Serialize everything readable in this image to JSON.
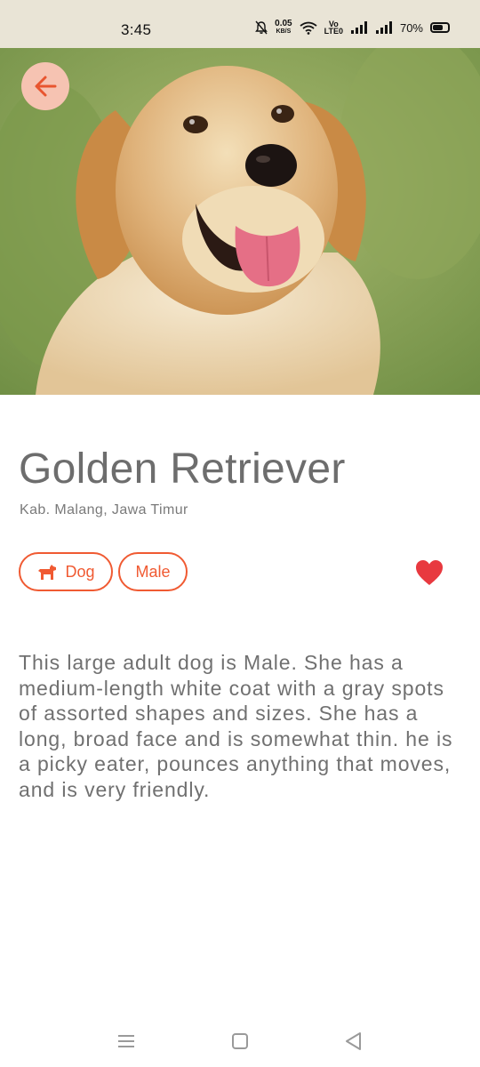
{
  "status_bar": {
    "time": "3:45",
    "net_speed_value": "0.05",
    "net_speed_unit": "KB/S",
    "volte_top": "Vo",
    "volte_bottom": "LTE0",
    "battery_percent": "70%",
    "battery_level": 0.7
  },
  "pet": {
    "name": "Golden Retriever",
    "location": "Kab. Malang, Jawa Timur",
    "type_label": "Dog",
    "gender_label": "Male",
    "favorited": true,
    "description": "This large adult dog is Male.  She has a medium-length white coat with a gray spots of assorted shapes and sizes.  She has a long, broad face and is somewhat thin.  he is a picky eater, pounces anything that moves, and is very friendly."
  },
  "colors": {
    "accent": "#f05a32",
    "heart": "#e8393f",
    "back_button_bg": "#f6c3b2",
    "text_gray": "#6d6d6d"
  },
  "icons": {
    "back": "arrow-left-icon",
    "dog": "dog-icon",
    "favorite": "heart-icon",
    "nav_menu": "menu-icon",
    "nav_home": "square-icon",
    "nav_back": "triangle-back-icon"
  }
}
